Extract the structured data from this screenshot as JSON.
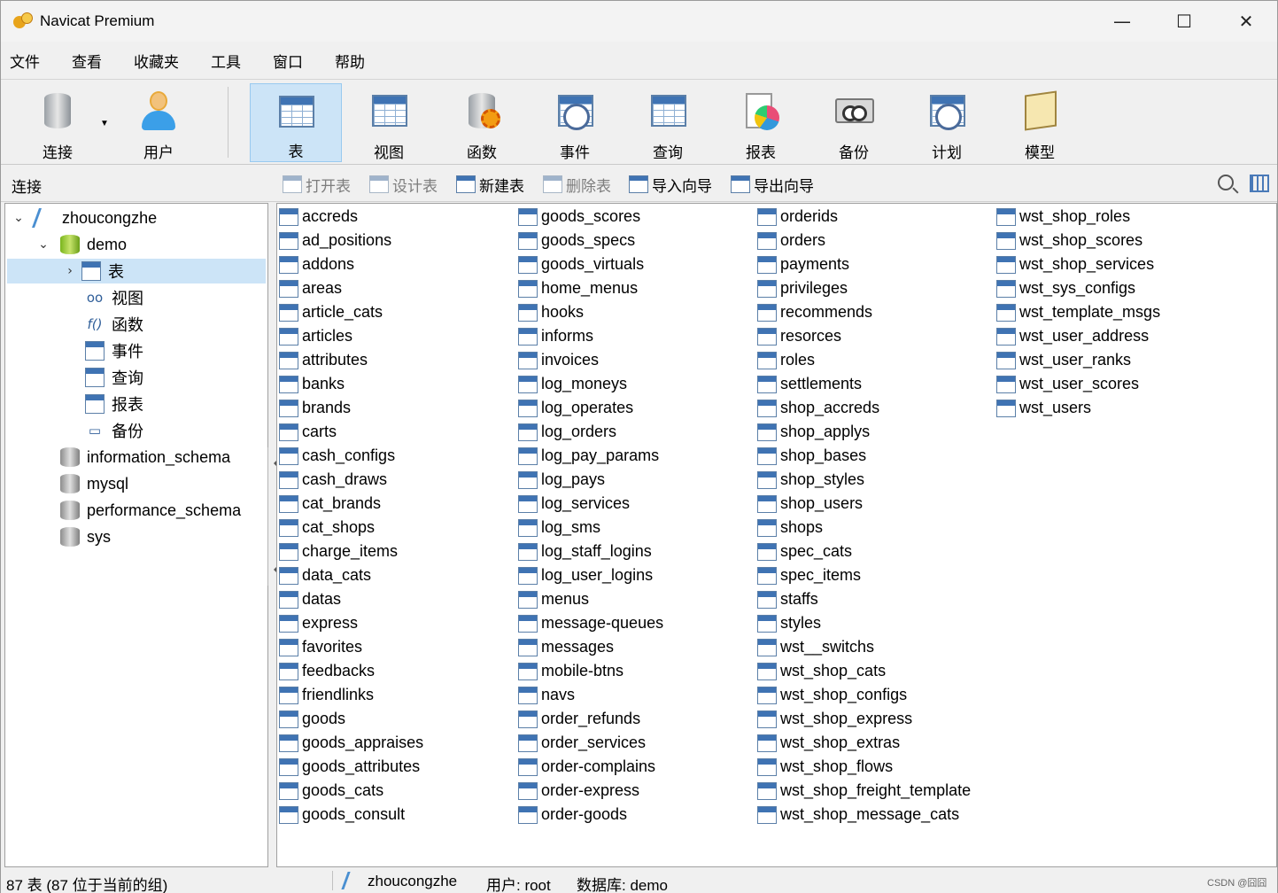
{
  "window": {
    "title": "Navicat Premium",
    "controls": {
      "minimize": "—",
      "maximize": "☐",
      "close": "✕"
    }
  },
  "menu": [
    "文件",
    "查看",
    "收藏夹",
    "工具",
    "窗口",
    "帮助"
  ],
  "toolbar": {
    "connect": "连接",
    "user": "用户",
    "table": "表",
    "view": "视图",
    "function": "函数",
    "event": "事件",
    "query": "查询",
    "report": "报表",
    "backup": "备份",
    "schedule": "计划",
    "model": "模型"
  },
  "objbar": {
    "connections_label": "连接",
    "open_table": "打开表",
    "design_table": "设计表",
    "new_table": "新建表",
    "delete_table": "删除表",
    "import_wizard": "导入向导",
    "export_wizard": "导出向导"
  },
  "tree": {
    "connection": "zhoucongzhe",
    "database": "demo",
    "children": [
      "表",
      "视图",
      "函数",
      "事件",
      "查询",
      "报表",
      "备份"
    ],
    "other_databases": [
      "information_schema",
      "mysql",
      "performance_schema",
      "sys"
    ]
  },
  "tables": {
    "col1": [
      "accreds",
      "ad_positions",
      "addons",
      "areas",
      "article_cats",
      "articles",
      "attributes",
      "banks",
      "brands",
      "carts",
      "cash_configs",
      "cash_draws",
      "cat_brands",
      "cat_shops",
      "charge_items",
      "data_cats",
      "datas",
      "express",
      "favorites",
      "feedbacks",
      "friendlinks",
      "goods",
      "goods_appraises",
      "goods_attributes",
      "goods_cats",
      "goods_consult"
    ],
    "col2": [
      "goods_scores",
      "goods_specs",
      "goods_virtuals",
      "home_menus",
      "hooks",
      "informs",
      "invoices",
      "log_moneys",
      "log_operates",
      "log_orders",
      "log_pay_params",
      "log_pays",
      "log_services",
      "log_sms",
      "log_staff_logins",
      "log_user_logins",
      "menus",
      "message-queues",
      "messages",
      "mobile-btns",
      "navs",
      "order_refunds",
      "order_services",
      "order-complains",
      "order-express",
      "order-goods"
    ],
    "col3": [
      "orderids",
      "orders",
      "payments",
      "privileges",
      "recommends",
      "resorces",
      "roles",
      "settlements",
      "shop_accreds",
      "shop_applys",
      "shop_bases",
      "shop_styles",
      "shop_users",
      "shops",
      "spec_cats",
      "spec_items",
      "staffs",
      "styles",
      "wst__switchs",
      "wst_shop_cats",
      "wst_shop_configs",
      "wst_shop_express",
      "wst_shop_extras",
      "wst_shop_flows",
      "wst_shop_freight_template",
      "wst_shop_message_cats"
    ],
    "col4": [
      "wst_shop_roles",
      "wst_shop_scores",
      "wst_shop_services",
      "wst_sys_configs",
      "wst_template_msgs",
      "wst_user_address",
      "wst_user_ranks",
      "wst_user_scores",
      "wst_users"
    ]
  },
  "status": {
    "count": "87 表 (87 位于当前的组)",
    "connection": "zhoucongzhe",
    "user": "用户: root",
    "database": "数据库: demo",
    "watermark": "CSDN @囧囧"
  }
}
